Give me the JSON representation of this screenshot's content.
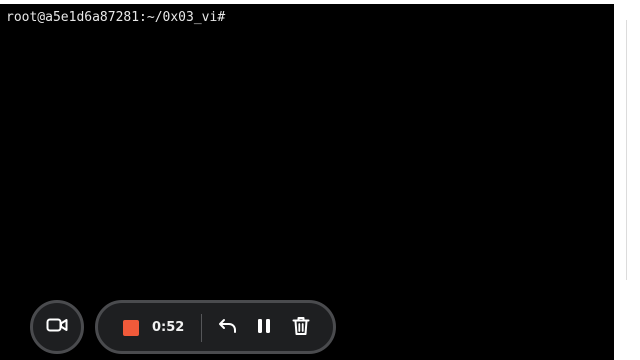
{
  "terminal": {
    "prompt": "root@a5e1d6a87281:~/0x03_vi#"
  },
  "recorder": {
    "elapsed": "0:52",
    "stop_color": "#f15a3a"
  },
  "icons": {
    "camera": "video-camera-icon",
    "stop": "stop-square-icon",
    "undo": "undo-arrow-icon",
    "pause": "pause-icon",
    "delete": "trash-icon"
  }
}
